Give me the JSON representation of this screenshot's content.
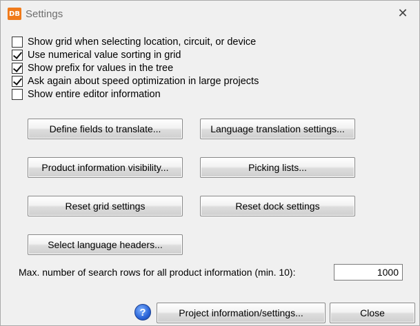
{
  "window": {
    "title": "Settings",
    "app_icon_text": "DB",
    "close_glyph": "✕"
  },
  "options": [
    {
      "label": "Show grid when selecting location, circuit, or device",
      "checked": false
    },
    {
      "label": "Use numerical value sorting in grid",
      "checked": true
    },
    {
      "label": "Show prefix for values in the tree",
      "checked": true
    },
    {
      "label": "Ask again about speed optimization in large projects",
      "checked": true
    },
    {
      "label": "Show entire editor information",
      "checked": false
    }
  ],
  "buttons": {
    "define_fields": "Define fields to translate...",
    "language_translation": "Language translation settings...",
    "product_visibility": "Product information visibility...",
    "picking_lists": "Picking lists...",
    "reset_grid": "Reset grid settings",
    "reset_dock": "Reset dock settings",
    "select_language_headers": "Select language headers...",
    "project_info": "Project information/settings...",
    "close": "Close"
  },
  "search_rows": {
    "label": "Max. number of search rows for all product information (min. 10):",
    "value": "1000"
  },
  "help_icon_glyph": "?"
}
